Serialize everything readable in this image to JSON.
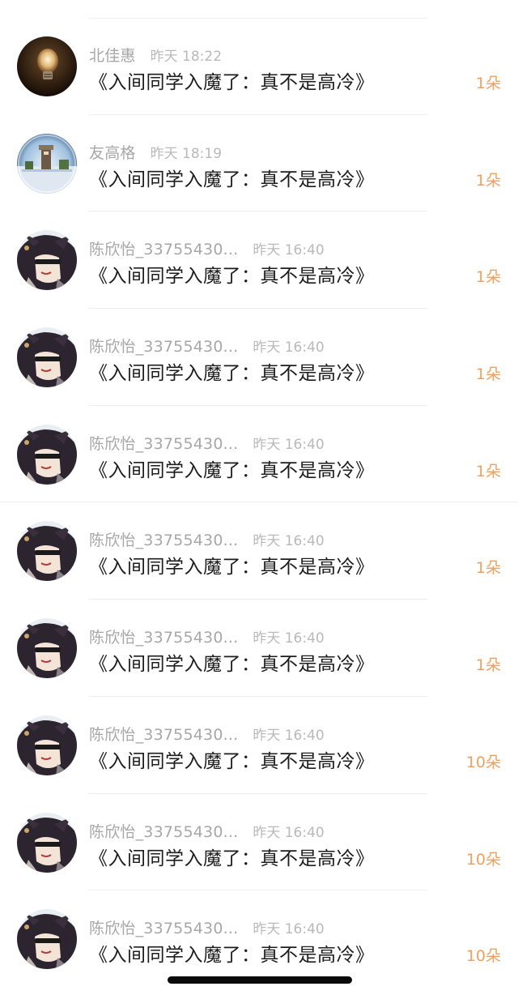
{
  "gifts": [
    {
      "avatar": "lightbulb-avatar",
      "name": "北佳惠",
      "time": "昨天 18:22",
      "title": "《入间同学入魔了：真不是高冷》",
      "count": "1朵"
    },
    {
      "avatar": "globe-avatar",
      "name": "友高格",
      "time": "昨天 18:19",
      "title": "《入间同学入魔了：真不是高冷》",
      "count": "1朵"
    },
    {
      "avatar": "anime-avatar",
      "name": "陈欣怡_33755430...",
      "time": "昨天 16:40",
      "title": "《入间同学入魔了：真不是高冷》",
      "count": "1朵"
    },
    {
      "avatar": "anime-avatar",
      "name": "陈欣怡_33755430...",
      "time": "昨天 16:40",
      "title": "《入间同学入魔了：真不是高冷》",
      "count": "1朵"
    },
    {
      "avatar": "anime-avatar",
      "name": "陈欣怡_33755430...",
      "time": "昨天 16:40",
      "title": "《入间同学入魔了：真不是高冷》",
      "count": "1朵"
    },
    {
      "avatar": "anime-avatar",
      "name": "陈欣怡_33755430...",
      "time": "昨天 16:40",
      "title": "《入间同学入魔了：真不是高冷》",
      "count": "1朵"
    },
    {
      "avatar": "anime-avatar",
      "name": "陈欣怡_33755430...",
      "time": "昨天 16:40",
      "title": "《入间同学入魔了：真不是高冷》",
      "count": "1朵"
    },
    {
      "avatar": "anime-avatar",
      "name": "陈欣怡_33755430...",
      "time": "昨天 16:40",
      "title": "《入间同学入魔了：真不是高冷》",
      "count": "10朵"
    },
    {
      "avatar": "anime-avatar",
      "name": "陈欣怡_33755430...",
      "time": "昨天 16:40",
      "title": "《入间同学入魔了：真不是高冷》",
      "count": "10朵"
    },
    {
      "avatar": "anime-avatar",
      "name": "陈欣怡_33755430...",
      "time": "昨天 16:40",
      "title": "《入间同学入魔了：真不是高冷》",
      "count": "10朵"
    }
  ],
  "colors": {
    "name": "#a7a7a7",
    "time": "#b9b9b9",
    "title": "#1d1d1d",
    "count": "#f0a060",
    "divider": "#ededed"
  }
}
